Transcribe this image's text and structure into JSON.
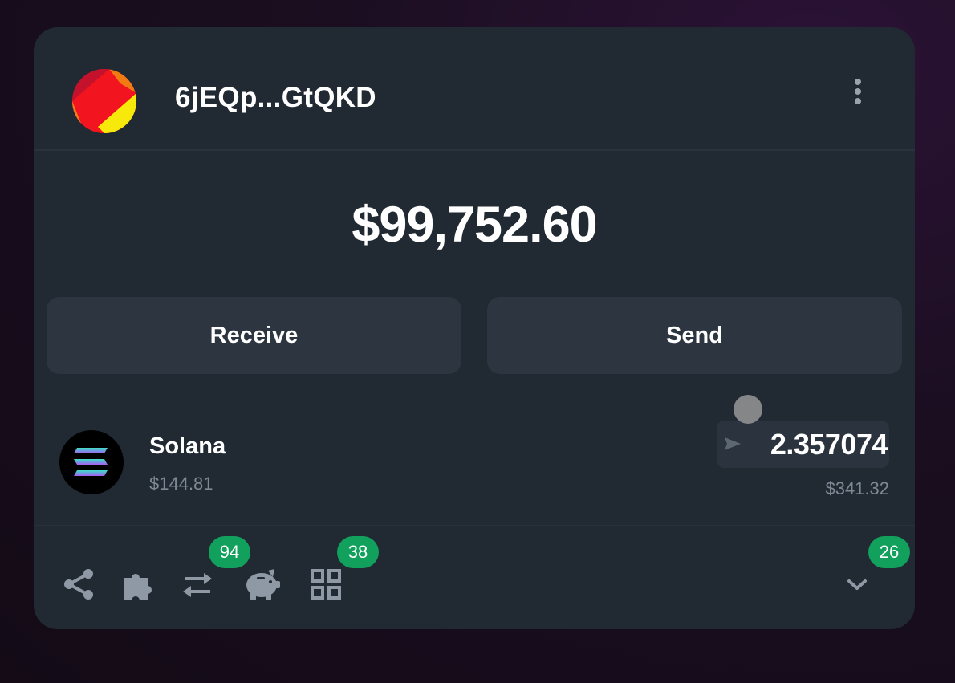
{
  "header": {
    "account_name": "6jEQp...GtQKD",
    "icons": [
      "avatar",
      "more-vertical-icon"
    ]
  },
  "balance": {
    "total": "$99,752.60"
  },
  "actions": {
    "receive_label": "Receive",
    "send_label": "Send"
  },
  "tokens": [
    {
      "name": "Solana",
      "price": "$144.81",
      "amount": "2.357074",
      "value": "$341.32",
      "icon": "solana-logo-icon"
    }
  ],
  "footer": {
    "icons": [
      "share-icon",
      "puzzle-icon",
      "swap-arrows-icon",
      "piggy-bank-icon",
      "grid-icon",
      "chevron-down-icon"
    ],
    "badges": {
      "swap": "94",
      "grid": "38",
      "chevron": "26"
    }
  },
  "colors": {
    "card_bg": "#212a33",
    "button_bg": "#2c3540",
    "badge_green": "#12a05d",
    "muted_text": "#7f8995"
  }
}
